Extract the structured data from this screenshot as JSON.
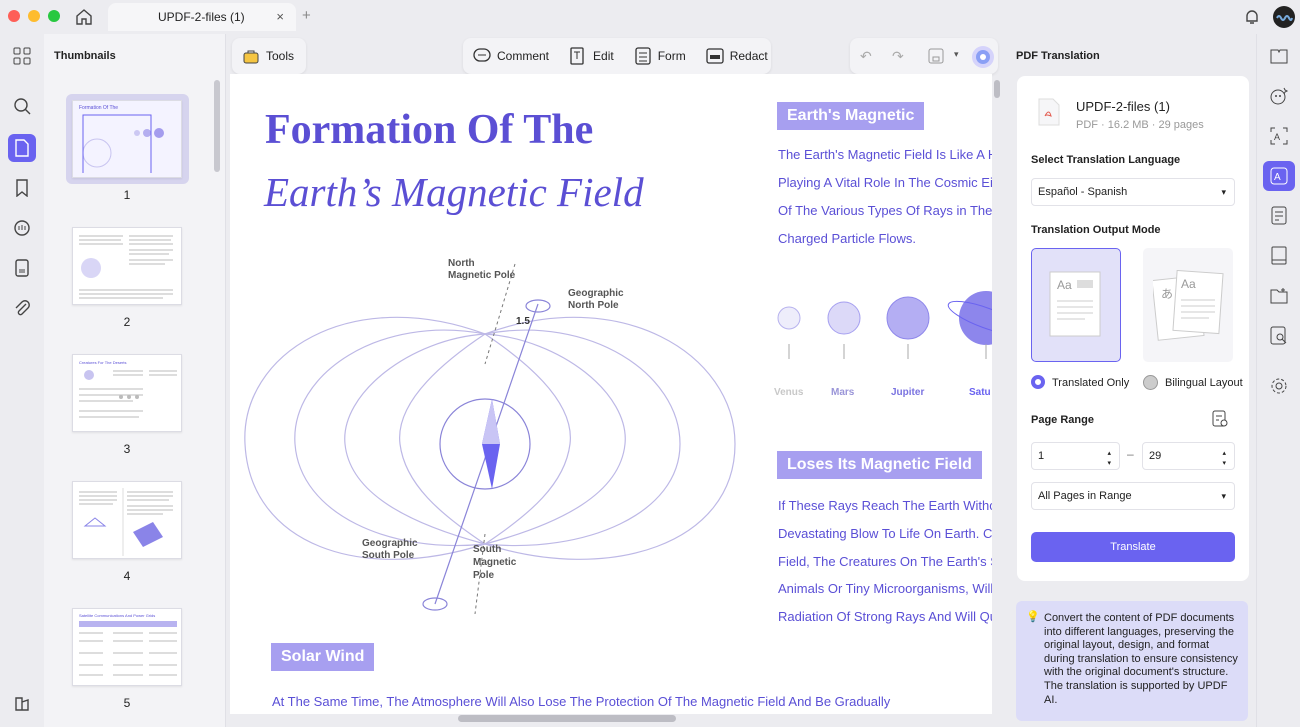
{
  "tab": {
    "title": "UPDF-2-files (1)",
    "close": "×",
    "new": "+"
  },
  "thumbnails": {
    "title": "Thumbnails",
    "pages": [
      "1",
      "2",
      "3",
      "4",
      "5"
    ]
  },
  "toolbar": {
    "tools": "Tools",
    "comment": "Comment",
    "edit": "Edit",
    "form": "Form",
    "redact": "Redact"
  },
  "document": {
    "title_line1": "Formation Of The",
    "title_line2": "Earth’s Magnetic Field",
    "diagram": {
      "north_mag": "North",
      "north_mag2": "Magnetic Pole",
      "geo_north": "Geographic",
      "geo_north2": "North Pole",
      "angle": "1.5",
      "geo_south": "Geographic",
      "geo_south2": "South Pole",
      "south_mag": "South",
      "south_mag2": "Magnetic",
      "south_mag3": "Pole"
    },
    "section1": {
      "heading": "Earth's Magnetic",
      "lines": [
        "The Earth's Magnetic Field Is Like A H",
        "Playing A Vital Role In The Cosmic Ei",
        "Of The Various Types Of Rays in The",
        "Charged Particle Flows."
      ]
    },
    "planets": [
      "Venus",
      "Mars",
      "Jupiter",
      "Satu"
    ],
    "section2": {
      "heading": "Loses Its Magnetic Field",
      "lines": [
        "If These Rays Reach The Earth Withc",
        "Devastating Blow To Life On Earth. C",
        "Field, The Creatures On The Earth's S",
        "Animals Or Tiny Microorganisms, Will",
        "Radiation Of Strong Rays And Will Qu"
      ]
    },
    "section3": {
      "heading": "Solar Wind",
      "line": "At The Same Time, The Atmosphere Will Also Lose The Protection Of The Magnetic Field And Be Gradually"
    }
  },
  "panel": {
    "title": "PDF Translation",
    "file": {
      "name": "UPDF-2-files (1)",
      "meta": "PDF · 16.2 MB · 29 pages"
    },
    "lang_label": "Select Translation Language",
    "lang_value": "Español - Spanish",
    "mode_label": "Translation Output Mode",
    "mode_translated": "Translated Only",
    "mode_bilingual": "Bilingual Layout",
    "range_label": "Page Range",
    "range_from": "1",
    "range_to": "29",
    "range_sep": "–",
    "range_mode": "All Pages in Range",
    "translate_button": "Translate",
    "tip": "Convert the content of PDF documents into different languages, preserving the original layout, design, and format during translation to ensure consistency with the original document's structure. The translation is supported by UPDF AI.",
    "tip_icon": "💡"
  },
  "colors": {
    "accent": "#6a63f0",
    "doc_purple": "#5a4fd6",
    "badge": "#a79ff0"
  }
}
